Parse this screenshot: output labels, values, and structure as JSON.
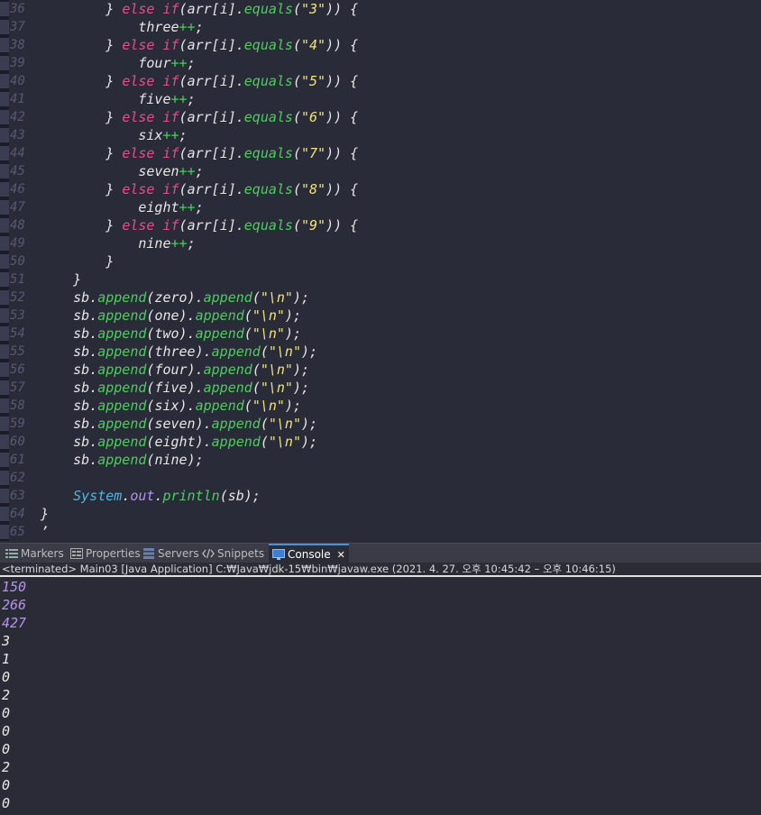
{
  "editor": {
    "lines": [
      {
        "n": "36",
        "tokens": [
          [
            "p",
            "        "
          ],
          [
            "p",
            "} "
          ],
          [
            "kw",
            "else "
          ],
          [
            "kw",
            "if"
          ],
          [
            "p",
            "("
          ],
          [
            "v",
            "arr"
          ],
          [
            "p",
            "["
          ],
          [
            "v",
            "i"
          ],
          [
            "p",
            "]."
          ],
          [
            "fn",
            "equals"
          ],
          [
            "p",
            "("
          ],
          [
            "s",
            "\"3\""
          ],
          [
            "p",
            "))"
          ],
          [
            "p",
            " {"
          ]
        ]
      },
      {
        "n": "37",
        "tokens": [
          [
            "p",
            "            "
          ],
          [
            "v",
            "three"
          ],
          [
            "op",
            "++"
          ],
          [
            "p",
            ";"
          ]
        ]
      },
      {
        "n": "38",
        "tokens": [
          [
            "p",
            "        "
          ],
          [
            "p",
            "} "
          ],
          [
            "kw",
            "else "
          ],
          [
            "kw",
            "if"
          ],
          [
            "p",
            "("
          ],
          [
            "v",
            "arr"
          ],
          [
            "p",
            "["
          ],
          [
            "v",
            "i"
          ],
          [
            "p",
            "]."
          ],
          [
            "fn",
            "equals"
          ],
          [
            "p",
            "("
          ],
          [
            "s",
            "\"4\""
          ],
          [
            "p",
            "))"
          ],
          [
            "p",
            " {"
          ]
        ]
      },
      {
        "n": "39",
        "tokens": [
          [
            "p",
            "            "
          ],
          [
            "v",
            "four"
          ],
          [
            "op",
            "++"
          ],
          [
            "p",
            ";"
          ]
        ]
      },
      {
        "n": "40",
        "tokens": [
          [
            "p",
            "        "
          ],
          [
            "p",
            "} "
          ],
          [
            "kw",
            "else "
          ],
          [
            "kw",
            "if"
          ],
          [
            "p",
            "("
          ],
          [
            "v",
            "arr"
          ],
          [
            "p",
            "["
          ],
          [
            "v",
            "i"
          ],
          [
            "p",
            "]."
          ],
          [
            "fn",
            "equals"
          ],
          [
            "p",
            "("
          ],
          [
            "s",
            "\"5\""
          ],
          [
            "p",
            "))"
          ],
          [
            "p",
            " {"
          ]
        ]
      },
      {
        "n": "41",
        "tokens": [
          [
            "p",
            "            "
          ],
          [
            "v",
            "five"
          ],
          [
            "op",
            "++"
          ],
          [
            "p",
            ";"
          ]
        ]
      },
      {
        "n": "42",
        "tokens": [
          [
            "p",
            "        "
          ],
          [
            "p",
            "} "
          ],
          [
            "kw",
            "else "
          ],
          [
            "kw",
            "if"
          ],
          [
            "p",
            "("
          ],
          [
            "v",
            "arr"
          ],
          [
            "p",
            "["
          ],
          [
            "v",
            "i"
          ],
          [
            "p",
            "]."
          ],
          [
            "fn",
            "equals"
          ],
          [
            "p",
            "("
          ],
          [
            "s",
            "\"6\""
          ],
          [
            "p",
            "))"
          ],
          [
            "p",
            " {"
          ]
        ]
      },
      {
        "n": "43",
        "tokens": [
          [
            "p",
            "            "
          ],
          [
            "v",
            "six"
          ],
          [
            "op",
            "++"
          ],
          [
            "p",
            ";"
          ]
        ]
      },
      {
        "n": "44",
        "tokens": [
          [
            "p",
            "        "
          ],
          [
            "p",
            "} "
          ],
          [
            "kw",
            "else "
          ],
          [
            "kw",
            "if"
          ],
          [
            "p",
            "("
          ],
          [
            "v",
            "arr"
          ],
          [
            "p",
            "["
          ],
          [
            "v",
            "i"
          ],
          [
            "p",
            "]."
          ],
          [
            "fn",
            "equals"
          ],
          [
            "p",
            "("
          ],
          [
            "s",
            "\"7\""
          ],
          [
            "p",
            "))"
          ],
          [
            "p",
            " {"
          ]
        ]
      },
      {
        "n": "45",
        "tokens": [
          [
            "p",
            "            "
          ],
          [
            "v",
            "seven"
          ],
          [
            "op",
            "++"
          ],
          [
            "p",
            ";"
          ]
        ]
      },
      {
        "n": "46",
        "tokens": [
          [
            "p",
            "        "
          ],
          [
            "p",
            "} "
          ],
          [
            "kw",
            "else "
          ],
          [
            "kw",
            "if"
          ],
          [
            "p",
            "("
          ],
          [
            "v",
            "arr"
          ],
          [
            "p",
            "["
          ],
          [
            "v",
            "i"
          ],
          [
            "p",
            "]."
          ],
          [
            "fn",
            "equals"
          ],
          [
            "p",
            "("
          ],
          [
            "s",
            "\"8\""
          ],
          [
            "p",
            "))"
          ],
          [
            "p",
            " {"
          ]
        ]
      },
      {
        "n": "47",
        "tokens": [
          [
            "p",
            "            "
          ],
          [
            "v",
            "eight"
          ],
          [
            "op",
            "++"
          ],
          [
            "p",
            ";"
          ]
        ]
      },
      {
        "n": "48",
        "tokens": [
          [
            "p",
            "        "
          ],
          [
            "p",
            "} "
          ],
          [
            "kw",
            "else "
          ],
          [
            "kw",
            "if"
          ],
          [
            "p",
            "("
          ],
          [
            "v",
            "arr"
          ],
          [
            "p",
            "["
          ],
          [
            "v",
            "i"
          ],
          [
            "p",
            "]."
          ],
          [
            "fn",
            "equals"
          ],
          [
            "p",
            "("
          ],
          [
            "s",
            "\"9\""
          ],
          [
            "p",
            "))"
          ],
          [
            "p",
            " {"
          ]
        ]
      },
      {
        "n": "49",
        "tokens": [
          [
            "p",
            "            "
          ],
          [
            "v",
            "nine"
          ],
          [
            "op",
            "++"
          ],
          [
            "p",
            ";"
          ]
        ]
      },
      {
        "n": "50",
        "tokens": [
          [
            "p",
            "        "
          ],
          [
            "p",
            "}"
          ]
        ]
      },
      {
        "n": "51",
        "tokens": [
          [
            "p",
            "    "
          ],
          [
            "p",
            "}"
          ]
        ]
      },
      {
        "n": "52",
        "tokens": [
          [
            "p",
            "    "
          ],
          [
            "v",
            "sb"
          ],
          [
            "p",
            "."
          ],
          [
            "fn",
            "append"
          ],
          [
            "p",
            "("
          ],
          [
            "v",
            "zero"
          ],
          [
            "p",
            ")."
          ],
          [
            "fn",
            "append"
          ],
          [
            "p",
            "("
          ],
          [
            "s",
            "\"\\n\""
          ],
          [
            "p",
            ");"
          ]
        ]
      },
      {
        "n": "53",
        "tokens": [
          [
            "p",
            "    "
          ],
          [
            "v",
            "sb"
          ],
          [
            "p",
            "."
          ],
          [
            "fn",
            "append"
          ],
          [
            "p",
            "("
          ],
          [
            "v",
            "one"
          ],
          [
            "p",
            ")."
          ],
          [
            "fn",
            "append"
          ],
          [
            "p",
            "("
          ],
          [
            "s",
            "\"\\n\""
          ],
          [
            "p",
            ");"
          ]
        ]
      },
      {
        "n": "54",
        "tokens": [
          [
            "p",
            "    "
          ],
          [
            "v",
            "sb"
          ],
          [
            "p",
            "."
          ],
          [
            "fn",
            "append"
          ],
          [
            "p",
            "("
          ],
          [
            "v",
            "two"
          ],
          [
            "p",
            ")."
          ],
          [
            "fn",
            "append"
          ],
          [
            "p",
            "("
          ],
          [
            "s",
            "\"\\n\""
          ],
          [
            "p",
            ");"
          ]
        ]
      },
      {
        "n": "55",
        "tokens": [
          [
            "p",
            "    "
          ],
          [
            "v",
            "sb"
          ],
          [
            "p",
            "."
          ],
          [
            "fn",
            "append"
          ],
          [
            "p",
            "("
          ],
          [
            "v",
            "three"
          ],
          [
            "p",
            ")."
          ],
          [
            "fn",
            "append"
          ],
          [
            "p",
            "("
          ],
          [
            "s",
            "\"\\n\""
          ],
          [
            "p",
            ");"
          ]
        ]
      },
      {
        "n": "56",
        "tokens": [
          [
            "p",
            "    "
          ],
          [
            "v",
            "sb"
          ],
          [
            "p",
            "."
          ],
          [
            "fn",
            "append"
          ],
          [
            "p",
            "("
          ],
          [
            "v",
            "four"
          ],
          [
            "p",
            ")."
          ],
          [
            "fn",
            "append"
          ],
          [
            "p",
            "("
          ],
          [
            "s",
            "\"\\n\""
          ],
          [
            "p",
            ");"
          ]
        ]
      },
      {
        "n": "57",
        "tokens": [
          [
            "p",
            "    "
          ],
          [
            "v",
            "sb"
          ],
          [
            "p",
            "."
          ],
          [
            "fn",
            "append"
          ],
          [
            "p",
            "("
          ],
          [
            "v",
            "five"
          ],
          [
            "p",
            ")."
          ],
          [
            "fn",
            "append"
          ],
          [
            "p",
            "("
          ],
          [
            "s",
            "\"\\n\""
          ],
          [
            "p",
            ");"
          ]
        ]
      },
      {
        "n": "58",
        "tokens": [
          [
            "p",
            "    "
          ],
          [
            "v",
            "sb"
          ],
          [
            "p",
            "."
          ],
          [
            "fn",
            "append"
          ],
          [
            "p",
            "("
          ],
          [
            "v",
            "six"
          ],
          [
            "p",
            ")."
          ],
          [
            "fn",
            "append"
          ],
          [
            "p",
            "("
          ],
          [
            "s",
            "\"\\n\""
          ],
          [
            "p",
            ");"
          ]
        ]
      },
      {
        "n": "59",
        "tokens": [
          [
            "p",
            "    "
          ],
          [
            "v",
            "sb"
          ],
          [
            "p",
            "."
          ],
          [
            "fn",
            "append"
          ],
          [
            "p",
            "("
          ],
          [
            "v",
            "seven"
          ],
          [
            "p",
            ")."
          ],
          [
            "fn",
            "append"
          ],
          [
            "p",
            "("
          ],
          [
            "s",
            "\"\\n\""
          ],
          [
            "p",
            ");"
          ]
        ]
      },
      {
        "n": "60",
        "tokens": [
          [
            "p",
            "    "
          ],
          [
            "v",
            "sb"
          ],
          [
            "p",
            "."
          ],
          [
            "fn",
            "append"
          ],
          [
            "p",
            "("
          ],
          [
            "v",
            "eight"
          ],
          [
            "p",
            ")."
          ],
          [
            "fn",
            "append"
          ],
          [
            "p",
            "("
          ],
          [
            "s",
            "\"\\n\""
          ],
          [
            "p",
            ");"
          ]
        ]
      },
      {
        "n": "61",
        "tokens": [
          [
            "p",
            "    "
          ],
          [
            "v",
            "sb"
          ],
          [
            "p",
            "."
          ],
          [
            "fn",
            "append"
          ],
          [
            "p",
            "("
          ],
          [
            "v",
            "nine"
          ],
          [
            "p",
            ");"
          ]
        ]
      },
      {
        "n": "62",
        "tokens": []
      },
      {
        "n": "63",
        "tokens": [
          [
            "p",
            "    "
          ],
          [
            "cls",
            "System"
          ],
          [
            "p",
            "."
          ],
          [
            "fld",
            "out"
          ],
          [
            "p",
            "."
          ],
          [
            "fn",
            "println"
          ],
          [
            "p",
            "("
          ],
          [
            "v",
            "sb"
          ],
          [
            "p",
            ");"
          ]
        ]
      },
      {
        "n": "64",
        "tokens": [
          [
            "p",
            "}"
          ]
        ]
      },
      {
        "n": "65",
        "tokens": [
          [
            "p",
            "’"
          ]
        ]
      }
    ]
  },
  "views": {
    "tabs": [
      {
        "id": "markers",
        "label": "Markers",
        "icon": "markers-icon",
        "active": false
      },
      {
        "id": "properties",
        "label": "Properties",
        "icon": "properties-icon",
        "active": false
      },
      {
        "id": "servers",
        "label": "Servers",
        "icon": "servers-icon",
        "active": false
      },
      {
        "id": "snippets",
        "label": "Snippets",
        "icon": "snippets-icon",
        "active": false
      },
      {
        "id": "console",
        "label": "Console",
        "icon": "console-icon",
        "active": true
      }
    ],
    "close_glyph": "✕"
  },
  "console": {
    "status": "<terminated> Main03 [Java Application] C:₩Java₩jdk-15₩bin₩javaw.exe  (2021. 4. 27. 오후 10:45:42 – 오후 10:46:15)",
    "output": [
      "150",
      "266",
      "427",
      "3",
      "1",
      "0",
      "2",
      "0",
      "0",
      "0",
      "2",
      "0",
      "0"
    ]
  }
}
